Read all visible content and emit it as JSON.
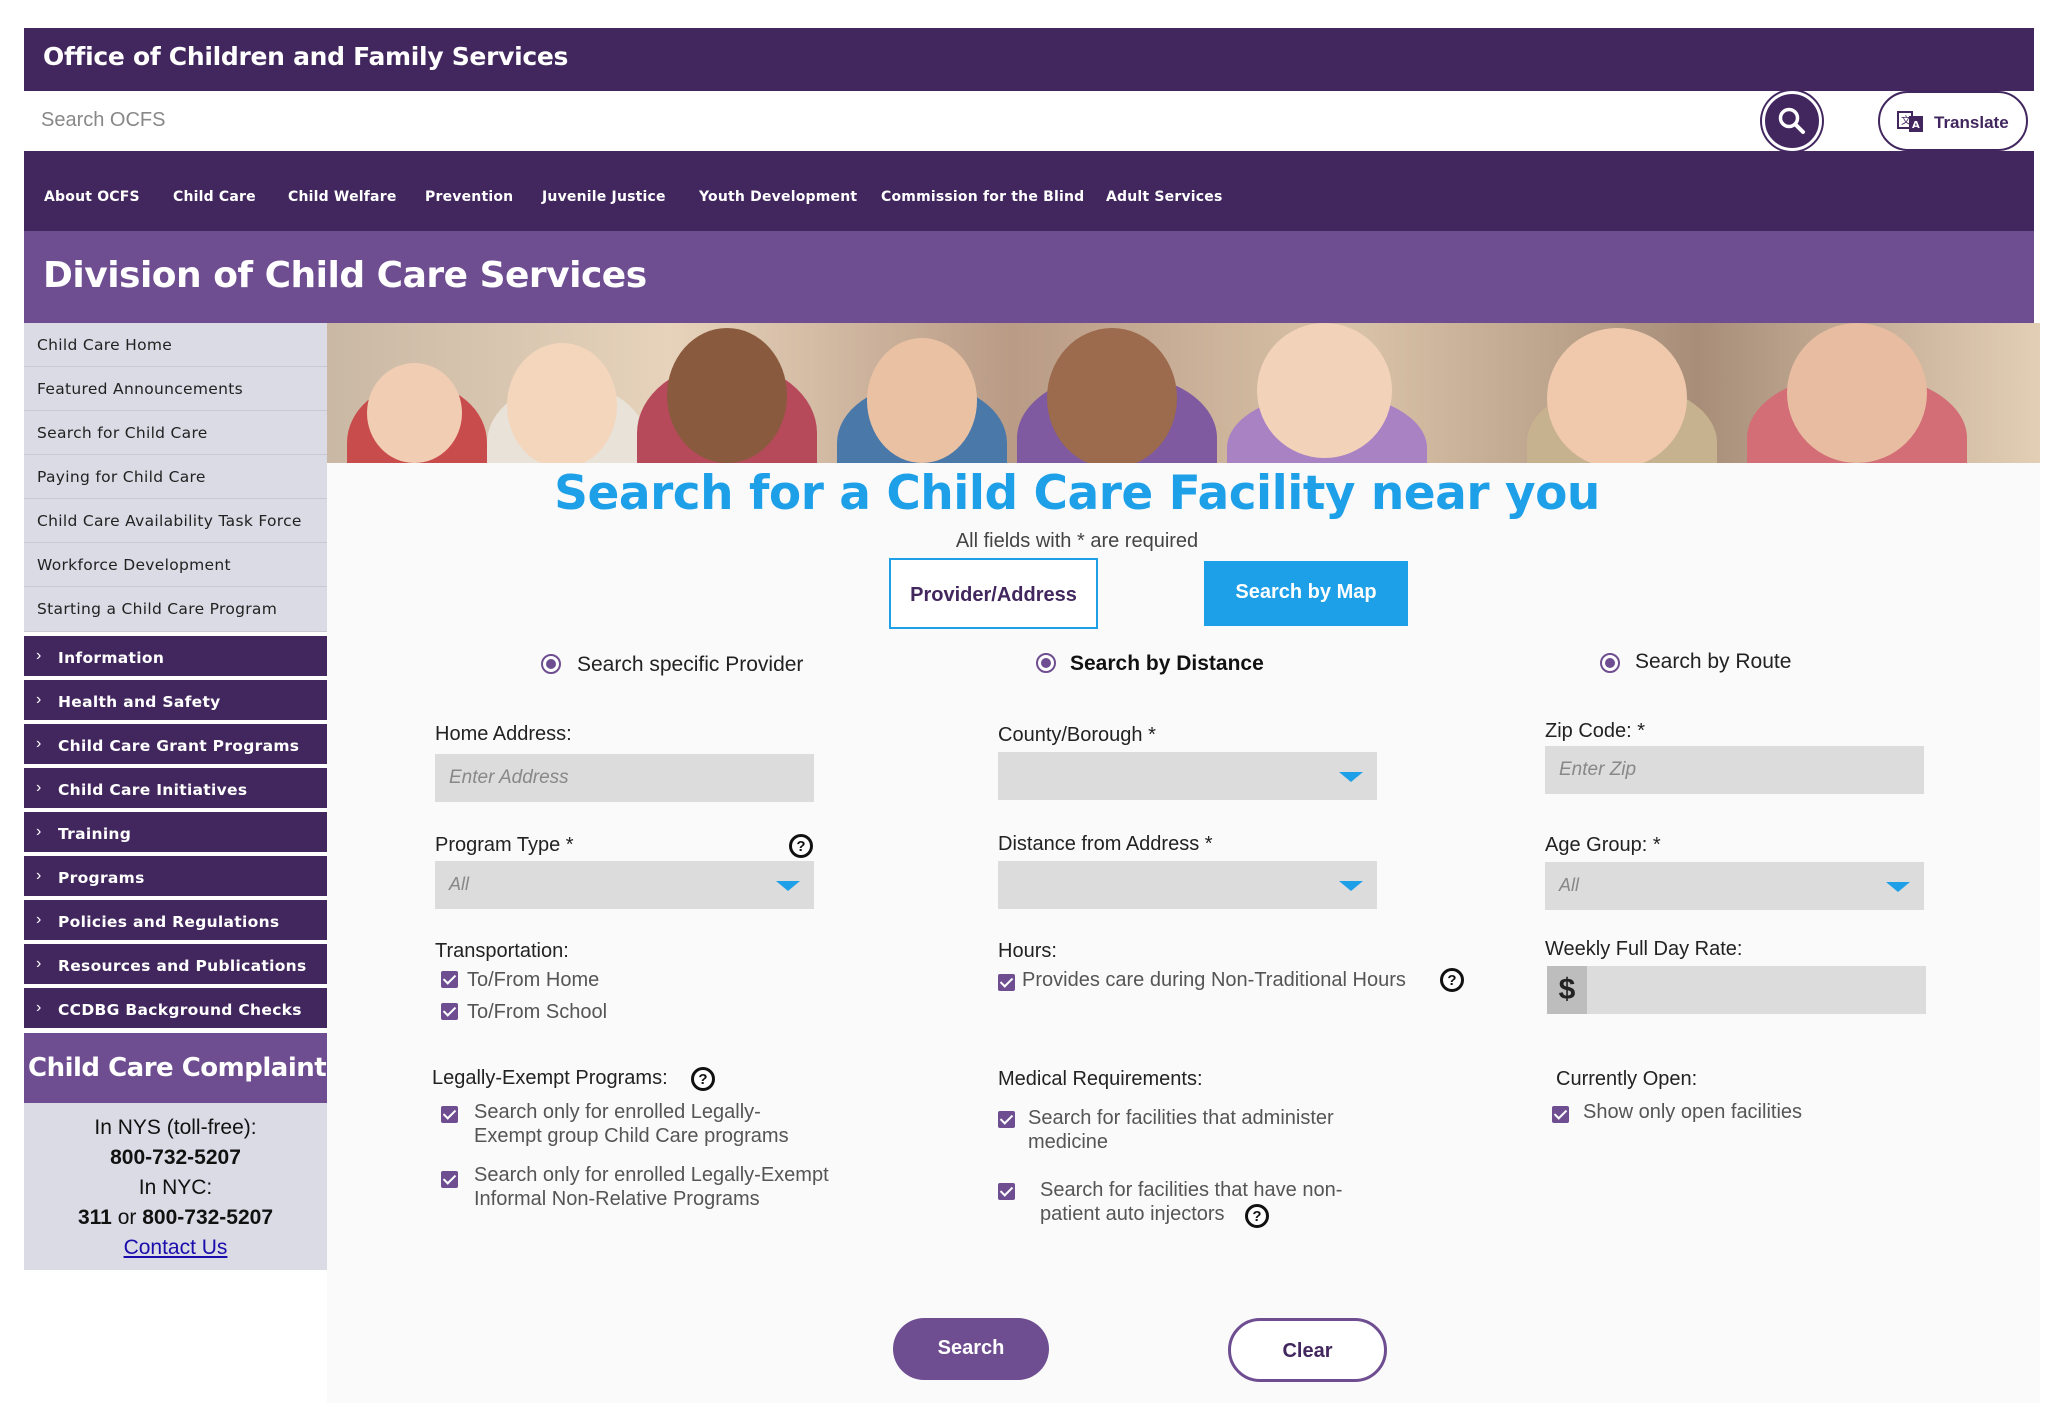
{
  "header": {
    "title": "Office of Children and Family Services",
    "search_placeholder": "Search OCFS",
    "translate_label": "Translate"
  },
  "nav": [
    "About OCFS",
    "Child Care",
    "Child Welfare",
    "Prevention",
    "Juvenile Justice",
    "Youth Development",
    "Commission for the Blind",
    "Adult Services"
  ],
  "division_title": "Division of Child Care Services",
  "sidebar": {
    "light_items": [
      "Child Care Home",
      "Featured Announcements",
      "Search for Child Care",
      "Paying for Child Care",
      "Child Care Availability Task Force",
      "Workforce Development",
      "Starting a Child Care Program"
    ],
    "dark_items": [
      "Information",
      "Health and Safety",
      "Child Care Grant Programs",
      "Child Care Initiatives",
      "Training",
      "Programs",
      "Policies and Regulations",
      "Resources and Publications",
      "CCDBG Background Checks"
    ],
    "complaints_title": "Child Care Complaints",
    "contact": {
      "nys_label": "In NYS (toll-free):",
      "nys_phone": "800-732-5207",
      "nyc_label": "In NYC:",
      "nyc_311": "311",
      "nyc_or": "or",
      "nyc_phone": "800-732-5207",
      "link": "Contact Us"
    }
  },
  "main": {
    "heading": "Search for a Child Care Facility near you",
    "required_note": "All fields with * are required",
    "tabs": {
      "provider": "Provider/Address",
      "map": "Search by Map"
    },
    "radios": {
      "provider": "Search specific Provider",
      "distance": "Search by Distance",
      "route": "Search by Route"
    },
    "fields": {
      "home_address": {
        "label": "Home Address:",
        "placeholder": "Enter Address"
      },
      "county": {
        "label": "County/Borough *"
      },
      "zip": {
        "label": "Zip Code: *",
        "placeholder": "Enter Zip"
      },
      "program_type": {
        "label": "Program Type *",
        "value": "All"
      },
      "distance": {
        "label": "Distance from Address *"
      },
      "age_group": {
        "label": "Age Group: *",
        "value": "All"
      },
      "transportation": {
        "label": "Transportation:",
        "options": [
          "To/From Home",
          "To/From School"
        ]
      },
      "hours": {
        "label": "Hours:",
        "option": "Provides care during Non-Traditional Hours"
      },
      "weekly_rate": {
        "label": "Weekly Full Day Rate:",
        "symbol": "$"
      },
      "legally_exempt": {
        "label": "Legally-Exempt Programs:",
        "options": [
          [
            "Search only for enrolled Legally-",
            "Exempt group Child Care programs"
          ],
          [
            "Search only for enrolled Legally-Exempt",
            "Informal Non-Relative Programs"
          ]
        ]
      },
      "medical": {
        "label": "Medical Requirements:",
        "options": [
          [
            "Search for facilities that administer",
            "medicine"
          ],
          [
            "Search for facilities that have non-",
            "patient auto injectors"
          ]
        ]
      },
      "currently_open": {
        "label": "Currently Open:",
        "option": "Show only open facilities"
      }
    },
    "buttons": {
      "search": "Search",
      "clear": "Clear"
    }
  },
  "colors": {
    "primary": "#42275e",
    "secondary": "#6e4e91",
    "accent": "#1ea0e8",
    "sidebar_bg": "#dbdbe6"
  }
}
